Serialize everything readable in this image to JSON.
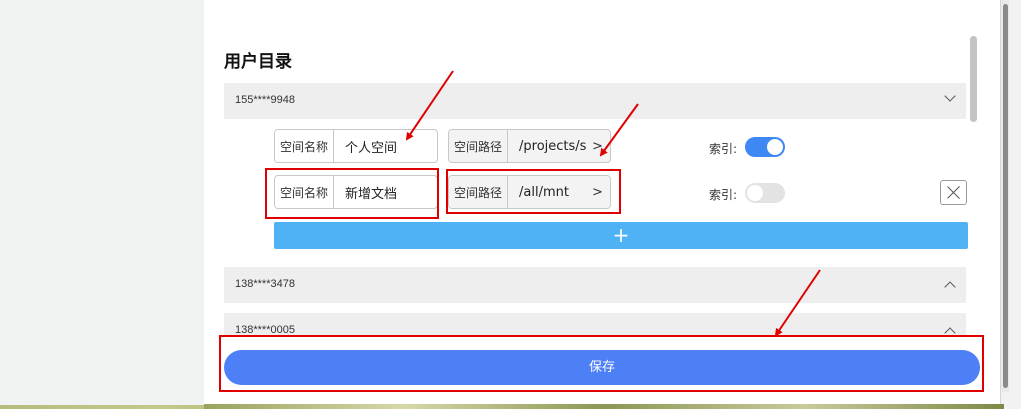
{
  "section_title": "用户目录",
  "users": [
    {
      "label": "155****9948",
      "expanded": true
    },
    {
      "label": "138****3478",
      "expanded": false
    },
    {
      "label": "138****0005",
      "expanded": false
    }
  ],
  "rows": [
    {
      "name_label": "空间名称",
      "name_value": "个人空间",
      "path_label": "空间路径",
      "path_value": "/projects/s",
      "path_arrow": ">",
      "index_label": "索引:",
      "index_on": true
    },
    {
      "name_label": "空间名称",
      "name_value": "新增文档",
      "path_label": "空间路径",
      "path_value": "/all/mnt",
      "path_arrow": ">",
      "index_label": "索引:",
      "index_on": false
    }
  ],
  "add_label": "+",
  "save_label": "保存",
  "colors": {
    "primary": "#4d7ff6",
    "add_bar": "#4fb2f5",
    "toggle_on": "#3d88f3",
    "annotation": "#e00000"
  }
}
